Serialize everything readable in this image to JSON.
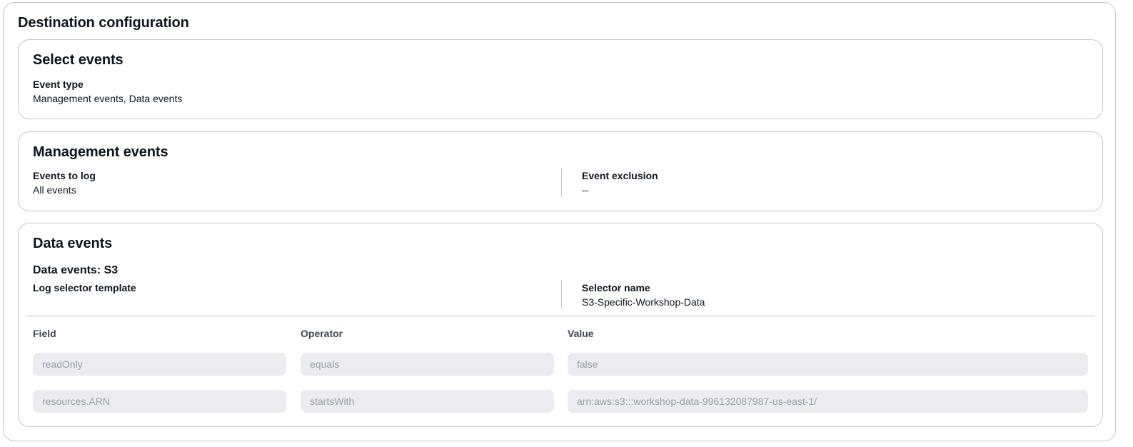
{
  "page": {
    "title": "Destination configuration"
  },
  "select_events": {
    "title": "Select events",
    "event_type_label": "Event type",
    "event_type_value": "Management events, Data events"
  },
  "management_events": {
    "title": "Management events",
    "events_to_log_label": "Events to log",
    "events_to_log_value": "All events",
    "event_exclusion_label": "Event exclusion",
    "event_exclusion_value": "--"
  },
  "data_events": {
    "title": "Data events",
    "subheading": "Data events: S3",
    "log_selector_template_label": "Log selector template",
    "selector_name_label": "Selector name",
    "selector_name_value": "S3-Specific-Workshop-Data",
    "columns": {
      "field": "Field",
      "operator": "Operator",
      "value": "Value"
    },
    "rows": [
      {
        "field": "readOnly",
        "operator": "equals",
        "value": "false"
      },
      {
        "field": "resources.ARN",
        "operator": "startsWith",
        "value": "arn:aws:s3:::workshop-data-996132087987-us-east-1/"
      }
    ]
  }
}
